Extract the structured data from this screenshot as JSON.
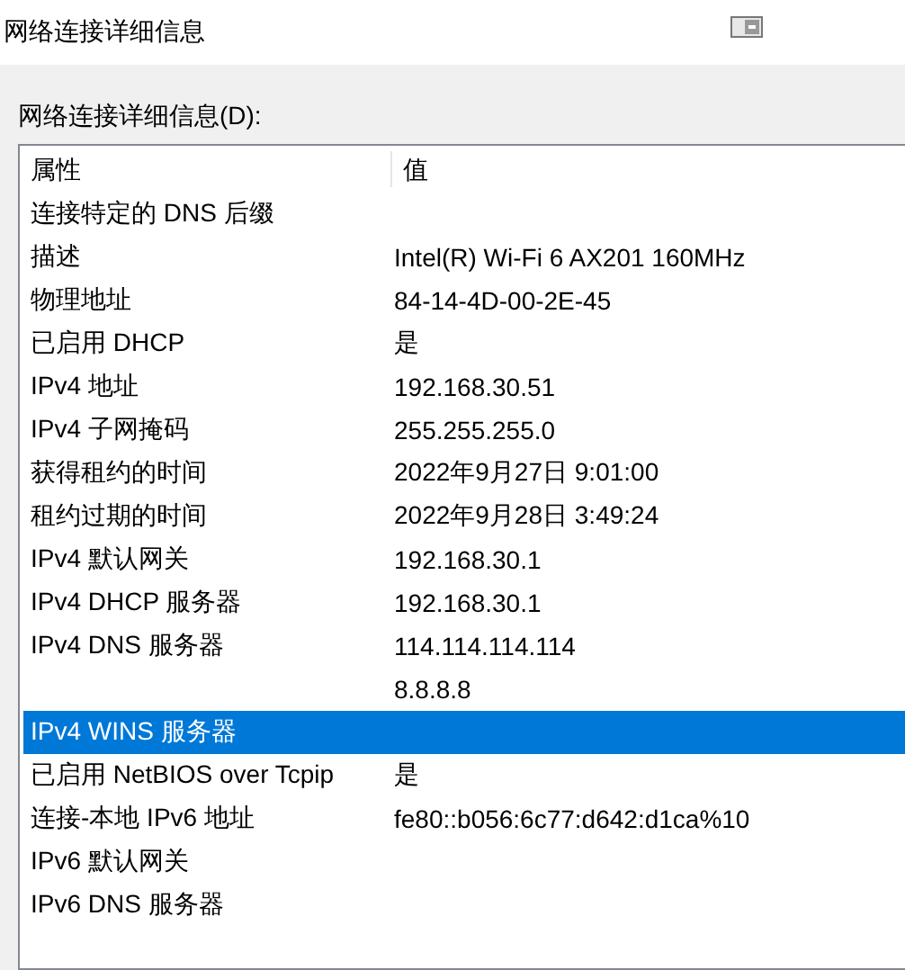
{
  "window": {
    "title": "网络连接详细信息"
  },
  "list_label": "网络连接详细信息(D):",
  "table": {
    "columns": [
      "属性",
      "值"
    ],
    "rows": [
      {
        "property": "连接特定的 DNS 后缀",
        "selected": false
      },
      {
        "property": "描述",
        "value": "Intel(R) Wi-Fi 6 AX201 160MHz",
        "selected": false
      },
      {
        "property": "物理地址",
        "value": "84-14-4D-00-2E-45",
        "selected": false
      },
      {
        "property": "已启用 DHCP",
        "value": "是",
        "selected": false
      },
      {
        "property": "IPv4 地址",
        "value": "192.168.30.51",
        "selected": false
      },
      {
        "property": "IPv4 子网掩码",
        "value": "255.255.255.0",
        "selected": false
      },
      {
        "property": "获得租约的时间",
        "value": "2022年9月27日 9:01:00",
        "selected": false
      },
      {
        "property": "租约过期的时间",
        "value": "2022年9月28日 3:49:24",
        "selected": false
      },
      {
        "property": "IPv4 默认网关",
        "value": "192.168.30.1",
        "selected": false
      },
      {
        "property": "IPv4 DHCP 服务器",
        "value": "192.168.30.1",
        "selected": false
      },
      {
        "property": "IPv4 DNS 服务器",
        "value": "114.114.114.114",
        "selected": false
      },
      {
        "value": "8.8.8.8",
        "selected": false
      },
      {
        "property": "IPv4 WINS 服务器",
        "selected": true
      },
      {
        "property": "已启用 NetBIOS over Tcpip",
        "value": "是",
        "selected": false
      },
      {
        "property": "连接-本地 IPv6 地址",
        "value": "fe80::b056:6c77:d642:d1ca%10",
        "selected": false
      },
      {
        "property": "IPv6 默认网关",
        "selected": false
      },
      {
        "property": "IPv6 DNS 服务器",
        "selected": false
      }
    ]
  }
}
